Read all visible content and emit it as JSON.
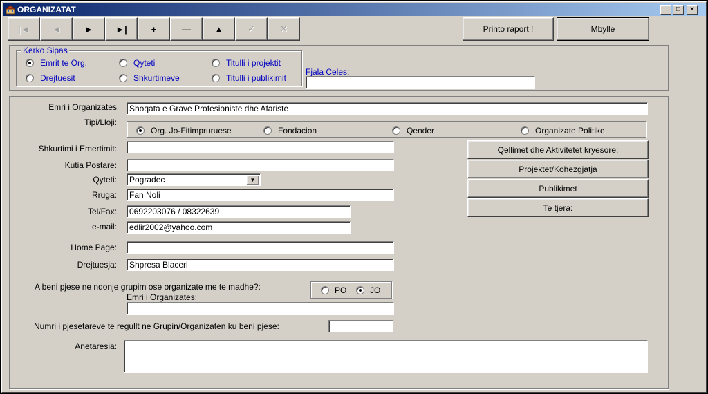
{
  "window": {
    "title": "ORGANIZATAT",
    "minimize_glyph": "_",
    "maximize_glyph": "□",
    "close_glyph": "×"
  },
  "toolbar": {
    "nav": [
      {
        "name": "first-record-button",
        "icon": "skip-to-start-icon",
        "glyph": "|◄",
        "enabled": false
      },
      {
        "name": "previous-record-button",
        "icon": "triangle-left-icon",
        "glyph": "◄",
        "enabled": false
      },
      {
        "name": "next-record-button",
        "icon": "triangle-right-icon",
        "glyph": "►",
        "enabled": true
      },
      {
        "name": "last-record-button",
        "icon": "skip-to-end-icon",
        "glyph": "►|",
        "enabled": true
      },
      {
        "name": "add-record-button",
        "icon": "plus-icon",
        "glyph": "+",
        "enabled": true
      },
      {
        "name": "delete-record-button",
        "icon": "minus-icon",
        "glyph": "—",
        "enabled": true
      },
      {
        "name": "up-button",
        "icon": "triangle-up-icon",
        "glyph": "▲",
        "enabled": true
      },
      {
        "name": "confirm-button",
        "icon": "checkmark-icon",
        "glyph": "✓",
        "enabled": false
      },
      {
        "name": "cancel-button",
        "icon": "x-icon",
        "glyph": "✕",
        "enabled": false
      }
    ],
    "print_label": "Printo raport !",
    "close_label": "Mbylle"
  },
  "search": {
    "legend": "Kerko Sipas",
    "options": [
      {
        "label": "Emrit te Org.",
        "selected": true
      },
      {
        "label": "Qyteti",
        "selected": false
      },
      {
        "label": "Titulli i projektit",
        "selected": false
      },
      {
        "label": "Drejtuesit",
        "selected": false
      },
      {
        "label": "Shkurtimeve",
        "selected": false
      },
      {
        "label": "Titulli i publikimit",
        "selected": false
      }
    ],
    "keyword_label": "Fjala Celes:",
    "keyword_value": ""
  },
  "form": {
    "name_label": "Emri i Organizates",
    "name_value": "Shoqata e Grave Profesioniste dhe Afariste",
    "type_label": "Tipi/Lloji:",
    "types": [
      {
        "label": "Org. Jo-Fitimpruruese",
        "selected": true
      },
      {
        "label": "Fondacion",
        "selected": false
      },
      {
        "label": "Qender",
        "selected": false
      },
      {
        "label": "Organizate Politike",
        "selected": false
      }
    ],
    "abbrev_label": "Shkurtimi i Emertimit:",
    "abbrev_value": "",
    "pobox_label": "Kutia Postare:",
    "pobox_value": "",
    "city_label": "Qyteti:",
    "city_value": "Pogradec",
    "street_label": "Rruga:",
    "street_value": "Fan Noli",
    "phone_label": "Tel/Fax:",
    "phone_value": "0692203076 / 08322639",
    "email_label": "e-mail:",
    "email_value": "edlir2002@yahoo.com",
    "homepage_label": "Home Page:",
    "homepage_value": "",
    "director_label": "Drejtuesja:",
    "director_value": "Shpresa Blaceri",
    "group_question": "A beni pjese ne ndonje grupim ose organizate me te madhe?:",
    "group_yes": "PO",
    "group_no": "JO",
    "group_answer": "JO",
    "group_org_label": "Emri i Organizates:",
    "group_org_value": "",
    "members_count_label": "Numri i pjesetareve te regullt ne Grupin/Organizaten ku beni pjese:",
    "members_count_value": "",
    "membership_label": "Anetaresia:",
    "membership_value": ""
  },
  "side_buttons": [
    "Qellimet dhe Aktivitetet kryesore:",
    "Projektet/Kohezgjatja",
    "Publikimet",
    "Te tjera:"
  ]
}
